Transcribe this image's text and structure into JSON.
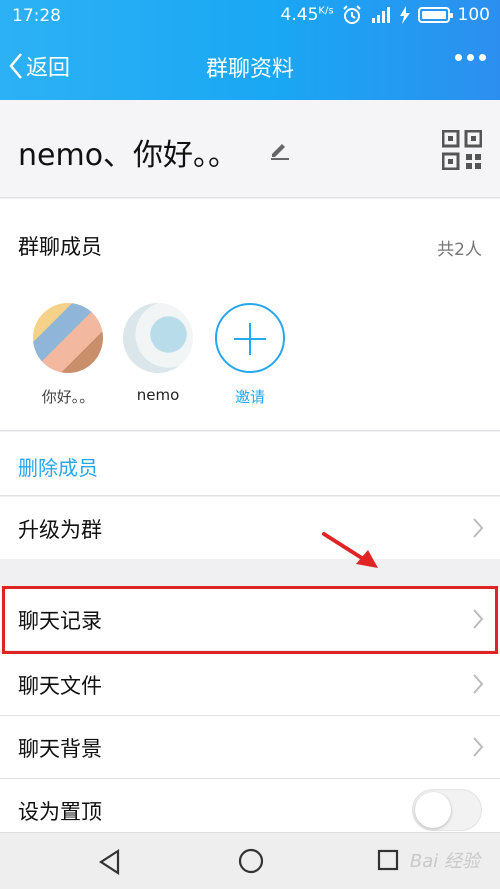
{
  "status_bar": {
    "time": "17:28",
    "speed": "4.45",
    "speed_unit": "K/s",
    "battery": "100"
  },
  "nav": {
    "back_label": "返回",
    "title": "群聊资料"
  },
  "group": {
    "name": "nemo、你好。。"
  },
  "members": {
    "label": "群聊成员",
    "count": "共2人",
    "list": [
      "你好。。",
      "nemo"
    ],
    "invite_label": "邀请"
  },
  "delete_members_label": "删除成员",
  "menu": {
    "upgrade": "升级为群",
    "chat_history": "聊天记录",
    "chat_files": "聊天文件",
    "chat_background": "聊天背景",
    "pin_top": "设为置顶"
  },
  "watermark": "Bai 经验",
  "colors": {
    "accent": "#27a7ee",
    "highlight": "#e02424"
  }
}
